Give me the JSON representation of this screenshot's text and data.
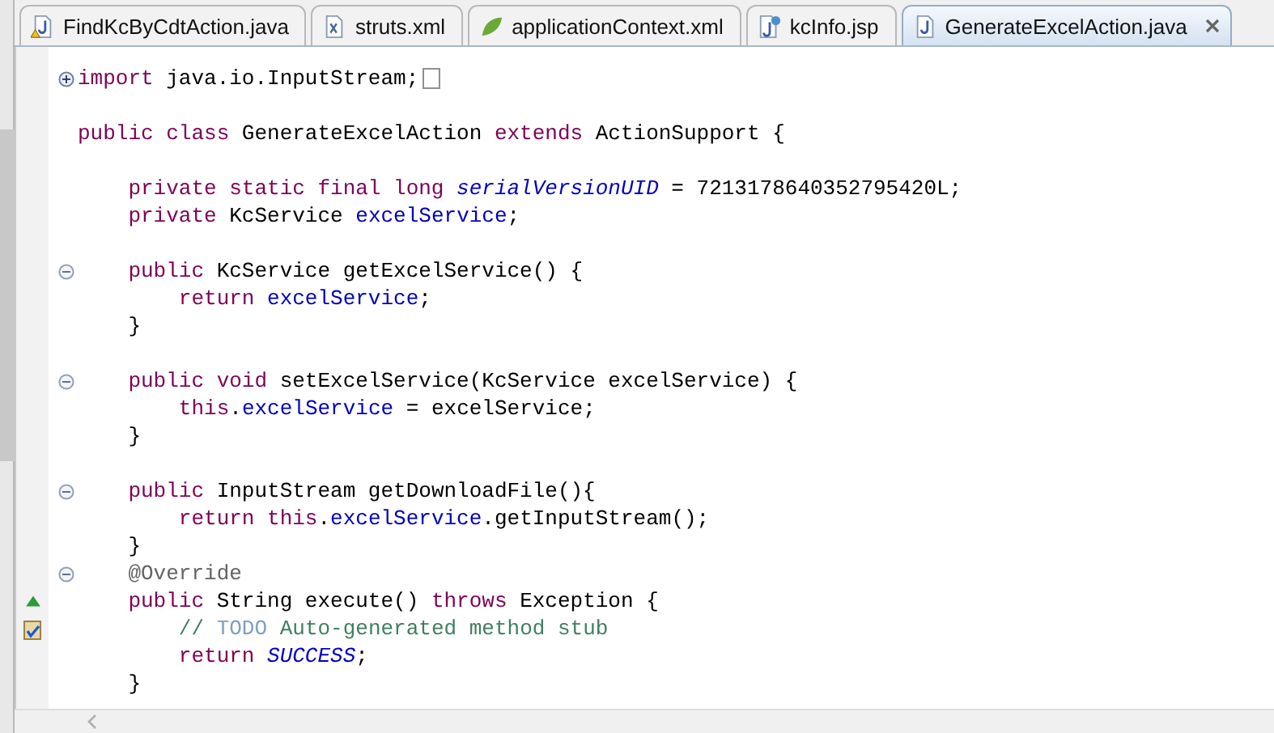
{
  "tabs": [
    {
      "label": "FindKcByCdtAction.java",
      "kind": "java-warning",
      "selected": false
    },
    {
      "label": "struts.xml",
      "kind": "xml",
      "selected": false
    },
    {
      "label": "applicationContext.xml",
      "kind": "spring",
      "selected": false
    },
    {
      "label": "kcInfo.jsp",
      "kind": "jsp",
      "selected": false
    },
    {
      "label": "GenerateExcelAction.java",
      "kind": "java",
      "selected": true
    }
  ],
  "code_lines": [
    {
      "kind": "code",
      "expanded": false,
      "tokens": [
        {
          "kind": "keyword",
          "text": "import"
        },
        {
          "kind": "plain",
          "text": " java.io.InputStream;"
        }
      ]
    },
    {
      "kind": "blank"
    },
    {
      "kind": "code",
      "tokens": [
        {
          "kind": "keyword",
          "text": "public class"
        },
        {
          "kind": "plain",
          "text": " GenerateExcelAction "
        },
        {
          "kind": "keyword",
          "text": "extends"
        },
        {
          "kind": "plain",
          "text": " ActionSupport {"
        }
      ]
    },
    {
      "kind": "blank"
    },
    {
      "kind": "code",
      "tokens": [
        {
          "kind": "keyword",
          "text": "    private static final long"
        },
        {
          "kind": "static",
          "text": " serialVersionUID"
        },
        {
          "kind": "plain",
          "text": " = 7213178640352795420L;"
        }
      ]
    },
    {
      "kind": "code",
      "tokens": [
        {
          "kind": "keyword",
          "text": "    private"
        },
        {
          "kind": "plain",
          "text": " KcService "
        },
        {
          "kind": "field",
          "text": "excelService"
        },
        {
          "kind": "plain",
          "text": ";"
        }
      ]
    },
    {
      "kind": "blank"
    },
    {
      "kind": "code",
      "expanded": true,
      "tokens": [
        {
          "kind": "keyword",
          "text": "    public"
        },
        {
          "kind": "plain",
          "text": " KcService getExcelService() {"
        }
      ]
    },
    {
      "kind": "code",
      "tokens": [
        {
          "kind": "keyword",
          "text": "        return"
        },
        {
          "kind": "field",
          "text": " excelService"
        },
        {
          "kind": "plain",
          "text": ";"
        }
      ]
    },
    {
      "kind": "code",
      "tokens": [
        {
          "kind": "plain",
          "text": "    }"
        }
      ]
    },
    {
      "kind": "blank"
    },
    {
      "kind": "code",
      "expanded": true,
      "tokens": [
        {
          "kind": "keyword",
          "text": "    public void"
        },
        {
          "kind": "plain",
          "text": " setExcelService(KcService excelService) {"
        }
      ]
    },
    {
      "kind": "code",
      "tokens": [
        {
          "kind": "keyword",
          "text": "        this"
        },
        {
          "kind": "plain",
          "text": "."
        },
        {
          "kind": "field",
          "text": "excelService"
        },
        {
          "kind": "plain",
          "text": " = excelService;"
        }
      ]
    },
    {
      "kind": "code",
      "tokens": [
        {
          "kind": "plain",
          "text": "    }"
        }
      ]
    },
    {
      "kind": "blank"
    },
    {
      "kind": "code",
      "expanded": true,
      "tokens": [
        {
          "kind": "keyword",
          "text": "    public"
        },
        {
          "kind": "plain",
          "text": " InputStream getDownloadFile(){"
        }
      ]
    },
    {
      "kind": "code",
      "tokens": [
        {
          "kind": "keyword",
          "text": "        return this"
        },
        {
          "kind": "plain",
          "text": "."
        },
        {
          "kind": "field",
          "text": "excelService"
        },
        {
          "kind": "plain",
          "text": ".getInputStream();"
        }
      ]
    },
    {
      "kind": "code",
      "tokens": [
        {
          "kind": "plain",
          "text": "    }"
        }
      ]
    },
    {
      "kind": "code",
      "expanded": true,
      "tokens": [
        {
          "kind": "annotation",
          "text": "    @Override"
        }
      ]
    },
    {
      "kind": "override",
      "tokens": [
        {
          "kind": "keyword",
          "text": "    public"
        },
        {
          "kind": "plain",
          "text": " String execute() "
        },
        {
          "kind": "keyword",
          "text": "throws"
        },
        {
          "kind": "plain",
          "text": " Exception {"
        }
      ]
    },
    {
      "kind": "task",
      "tokens": [
        {
          "kind": "comment",
          "text": "        // "
        },
        {
          "kind": "todo",
          "text": "TODO"
        },
        {
          "kind": "comment",
          "text": " Auto-generated method stub"
        }
      ]
    },
    {
      "kind": "code",
      "tokens": [
        {
          "kind": "keyword",
          "text": "        return"
        },
        {
          "kind": "static",
          "text": " SUCCESS"
        },
        {
          "kind": "plain",
          "text": ";"
        }
      ]
    },
    {
      "kind": "code",
      "tokens": [
        {
          "kind": "plain",
          "text": "    }"
        }
      ]
    }
  ]
}
